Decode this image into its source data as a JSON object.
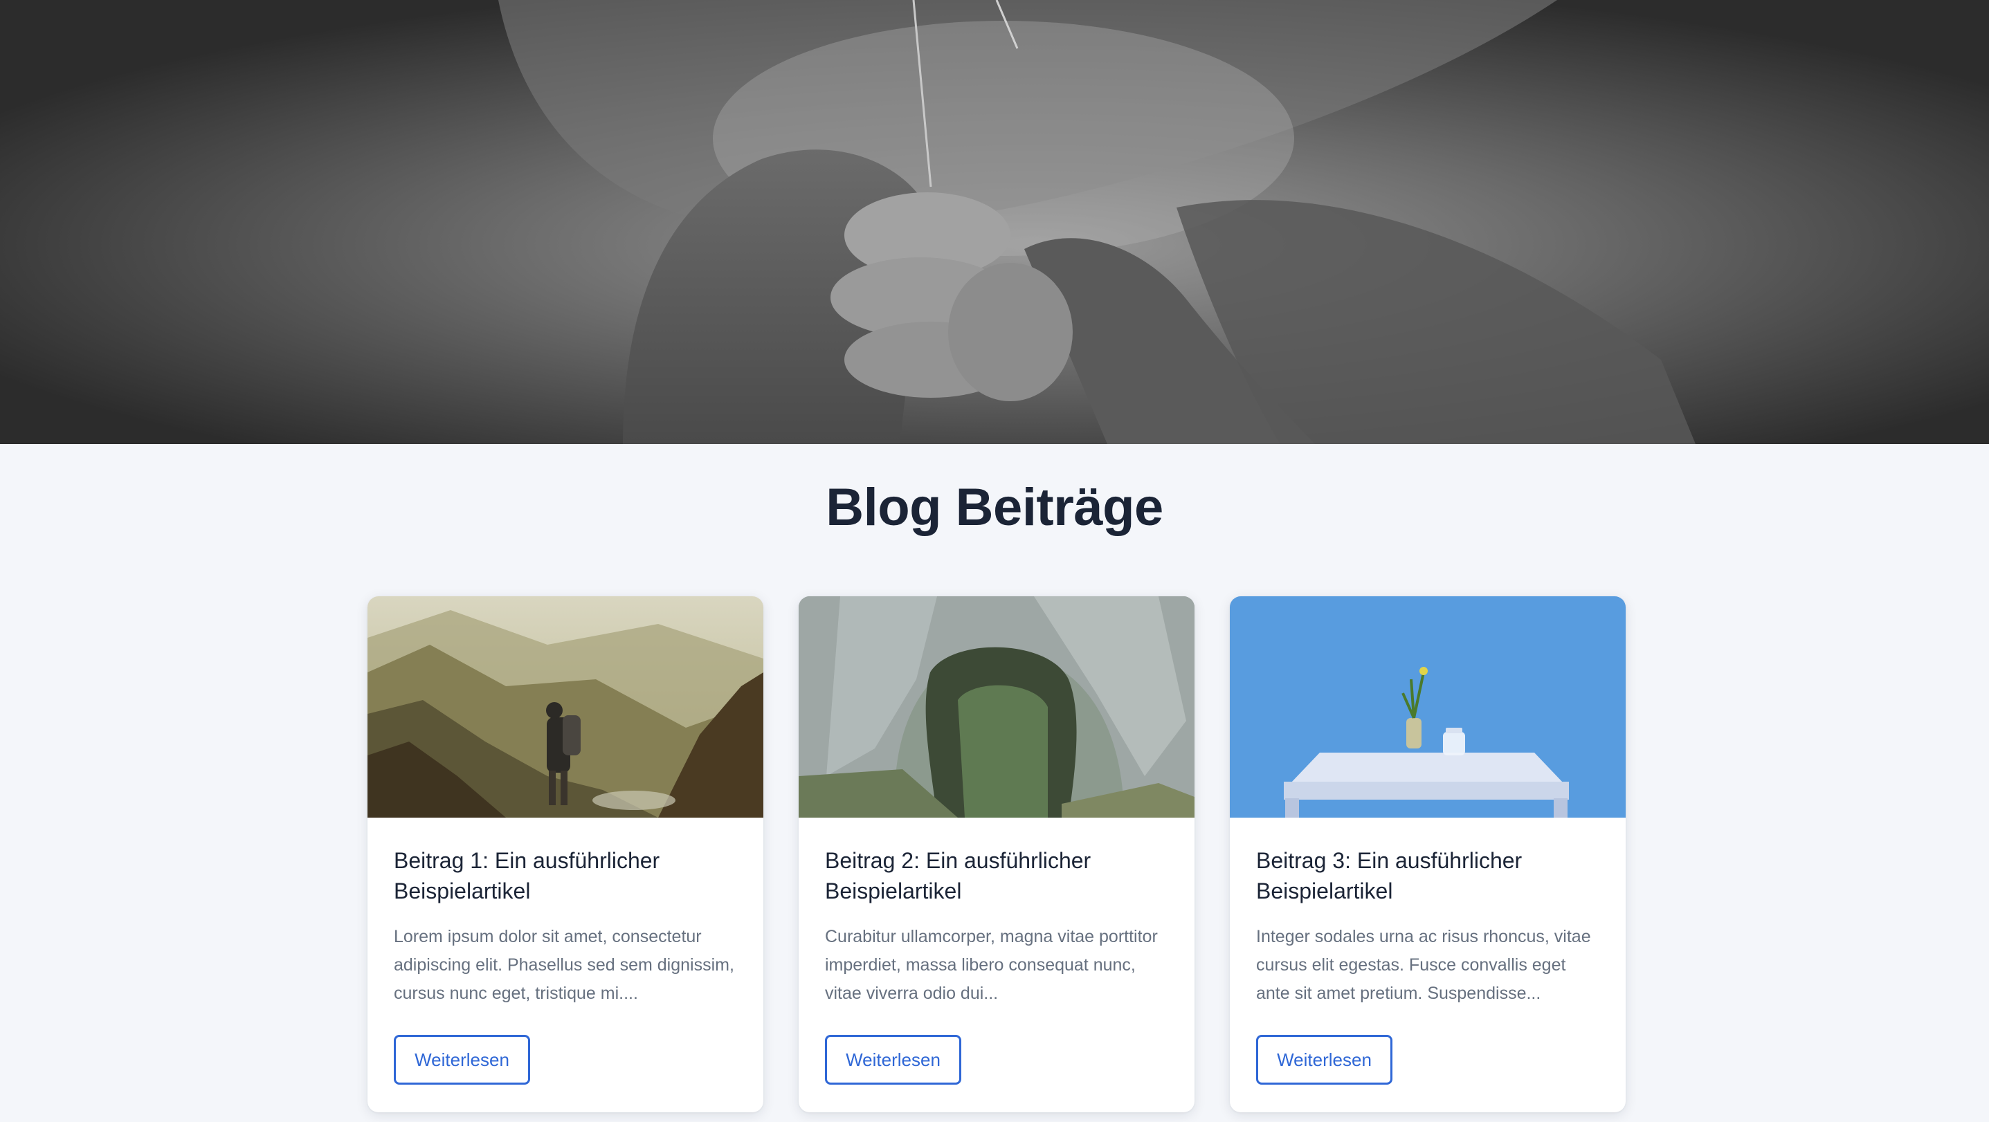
{
  "hero": {
    "image": "grayscale-hands-knitted-sweater-photo"
  },
  "section": {
    "title": "Blog Beiträge"
  },
  "posts": [
    {
      "image": "hiker-mountain-valley-photo",
      "title": "Beitrag 1: Ein ausführlicher Beispielartikel",
      "excerpt": "Lorem ipsum dolor sit amet, consectetur adipiscing elit. Phasellus sed sem dignissim, cursus nunc eget, tristique mi....",
      "button": "Weiterlesen"
    },
    {
      "image": "rock-arch-forest-photo",
      "title": "Beitrag 2: Ein ausführlicher Beispielartikel",
      "excerpt": "Curabitur ullamcorper, magna vitae porttitor imperdiet, massa libero consequat nunc, vitae viverra odio dui...",
      "button": "Weiterlesen"
    },
    {
      "image": "blue-wall-table-vase-photo",
      "title": "Beitrag 3: Ein ausführlicher Beispielartikel",
      "excerpt": "Integer sodales urna ac risus rhoncus, vitae cursus elit egestas. Fusce convallis eget ante sit amet pretium. Suspendisse...",
      "button": "Weiterlesen"
    }
  ],
  "colors": {
    "background": "#f4f6fa",
    "heading": "#1b2436",
    "body_text": "#66707f",
    "accent": "#2f67d6"
  }
}
